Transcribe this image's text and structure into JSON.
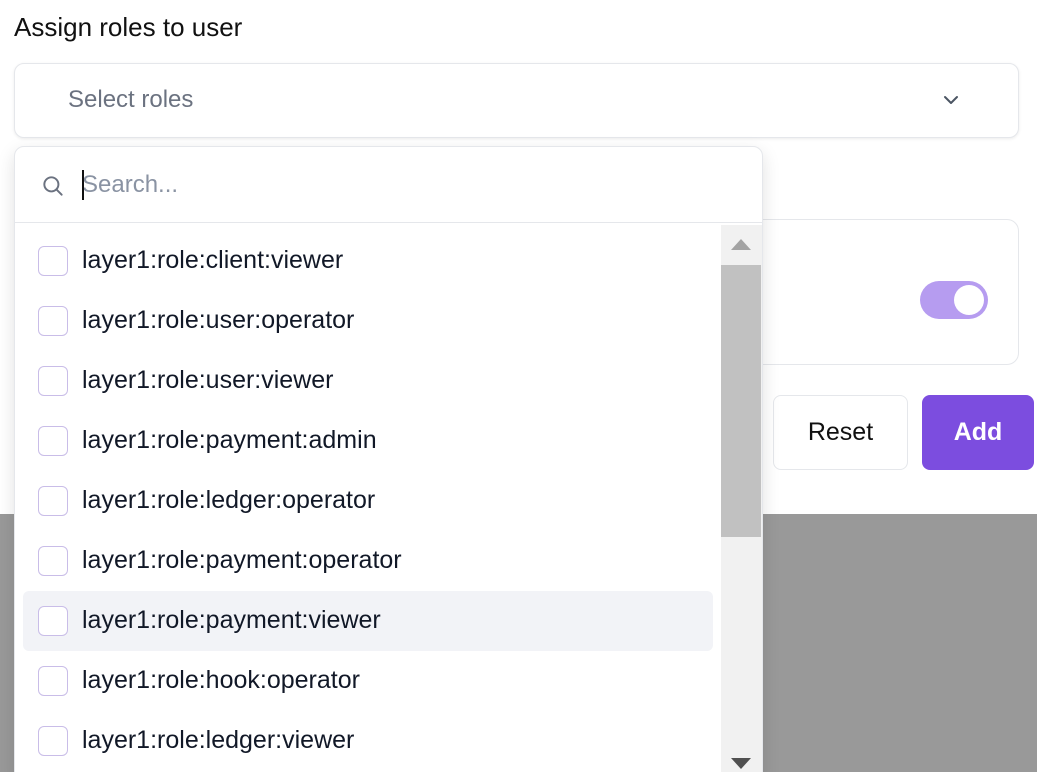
{
  "form": {
    "title": "Assign roles to user",
    "select_placeholder": "Select roles",
    "reset_label": "Reset",
    "add_label": "Add",
    "toggle_on": true
  },
  "dropdown": {
    "search_placeholder": "Search...",
    "items": [
      {
        "label": "layer1:role:client:viewer",
        "checked": false
      },
      {
        "label": "layer1:role:user:operator",
        "checked": false
      },
      {
        "label": "layer1:role:user:viewer",
        "checked": false
      },
      {
        "label": "layer1:role:payment:admin",
        "checked": false
      },
      {
        "label": "layer1:role:ledger:operator",
        "checked": false
      },
      {
        "label": "layer1:role:payment:operator",
        "checked": false
      },
      {
        "label": "layer1:role:payment:viewer",
        "checked": false,
        "hovered": true
      },
      {
        "label": "layer1:role:hook:operator",
        "checked": false
      },
      {
        "label": "layer1:role:ledger:viewer",
        "checked": false
      }
    ]
  },
  "colors": {
    "accent": "#7c4ddf",
    "toggle": "#b69cf0",
    "overlay": "#999999"
  },
  "icons": {
    "search": "search-icon",
    "chevron": "chevron-down-icon"
  }
}
